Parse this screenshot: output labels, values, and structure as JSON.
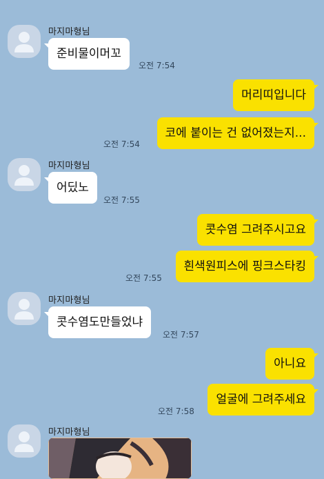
{
  "sender_name": "마지마형님",
  "messages": [
    {
      "text": "준비물이머꼬",
      "time": "오전 7:54"
    },
    {
      "text": "머리띠입니다"
    },
    {
      "text": "코에 붙이는 건 없어졌는지...",
      "time": "오전 7:54"
    },
    {
      "text": "어딨노",
      "time": "오전 7:55"
    },
    {
      "text": "콧수염 그려주시고요"
    },
    {
      "text": "흰색원피스에 핑크스타킹",
      "time": "오전 7:55"
    },
    {
      "text": "콧수염도만들었냐",
      "time": "오전 7:57"
    },
    {
      "text": "아니요"
    },
    {
      "text": "얼굴에 그려주세요",
      "time": "오전 7:58"
    }
  ]
}
